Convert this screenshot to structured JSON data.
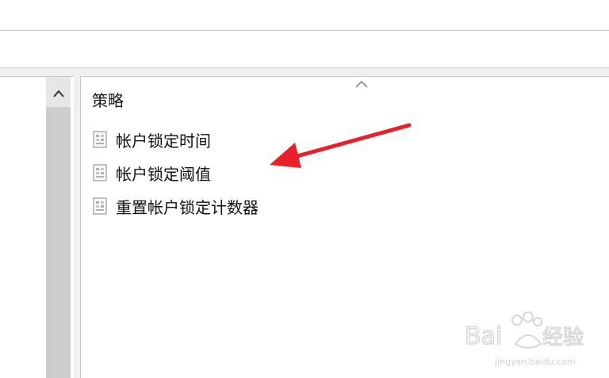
{
  "right_pane": {
    "column_header": "策略",
    "items": [
      {
        "label": "帐户锁定时间",
        "icon": "policy-setting-icon"
      },
      {
        "label": "帐户锁定阈值",
        "icon": "policy-setting-icon"
      },
      {
        "label": "重置帐户锁定计数器",
        "icon": "policy-setting-icon"
      }
    ]
  },
  "annotation": {
    "arrow_color": "#e8202a",
    "points_to": "帐户锁定阈值"
  },
  "watermark": {
    "logo_text": "Baidu经验",
    "url": "jingyan.baidu.com"
  },
  "colors": {
    "pane_bg": "#ffffff",
    "window_bg": "#f0f0f0",
    "scrollbar_thumb": "#cdcdcd"
  }
}
